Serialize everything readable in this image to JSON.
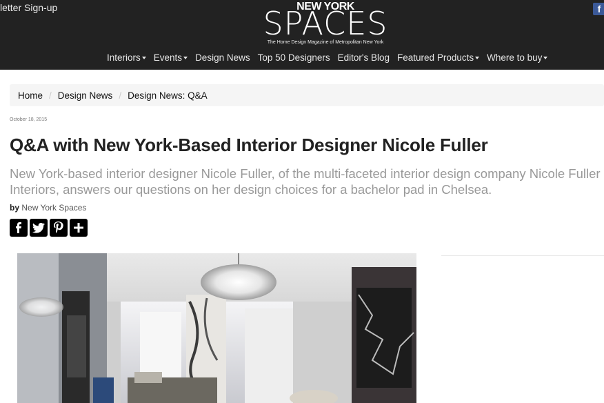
{
  "header": {
    "newsletter": "letter Sign-up",
    "logo_top": "NEW YORK",
    "logo_main": "SPACES",
    "logo_tagline": "The Home Design Magazine of Metropolitan New York",
    "social_icon": "facebook-icon"
  },
  "nav": [
    {
      "label": "Interiors",
      "dropdown": true
    },
    {
      "label": "Events",
      "dropdown": true
    },
    {
      "label": "Design News",
      "dropdown": false
    },
    {
      "label": "Top 50 Designers",
      "dropdown": false
    },
    {
      "label": "Editor's Blog",
      "dropdown": false
    },
    {
      "label": "Featured Products",
      "dropdown": true
    },
    {
      "label": "Where to buy",
      "dropdown": true
    }
  ],
  "breadcrumb": [
    "Home",
    "Design News",
    "Design News: Q&A"
  ],
  "article": {
    "date": "October 18, 2015",
    "title": "Q&A with New York-Based Interior Designer Nicole Fuller",
    "subtitle": "New York-based interior designer Nicole Fuller, of the multi-faceted interior design company Nicole Fuller Interiors, answers our questions on her design choices for a bachelor pad in Chelsea.",
    "by_label": "by",
    "author": "New York Spaces"
  },
  "share_buttons": [
    {
      "name": "facebook-share-icon",
      "glyph": "f"
    },
    {
      "name": "twitter-share-icon",
      "glyph": "t"
    },
    {
      "name": "pinterest-share-icon",
      "glyph": "p"
    },
    {
      "name": "more-share-icon",
      "glyph": "+"
    }
  ]
}
